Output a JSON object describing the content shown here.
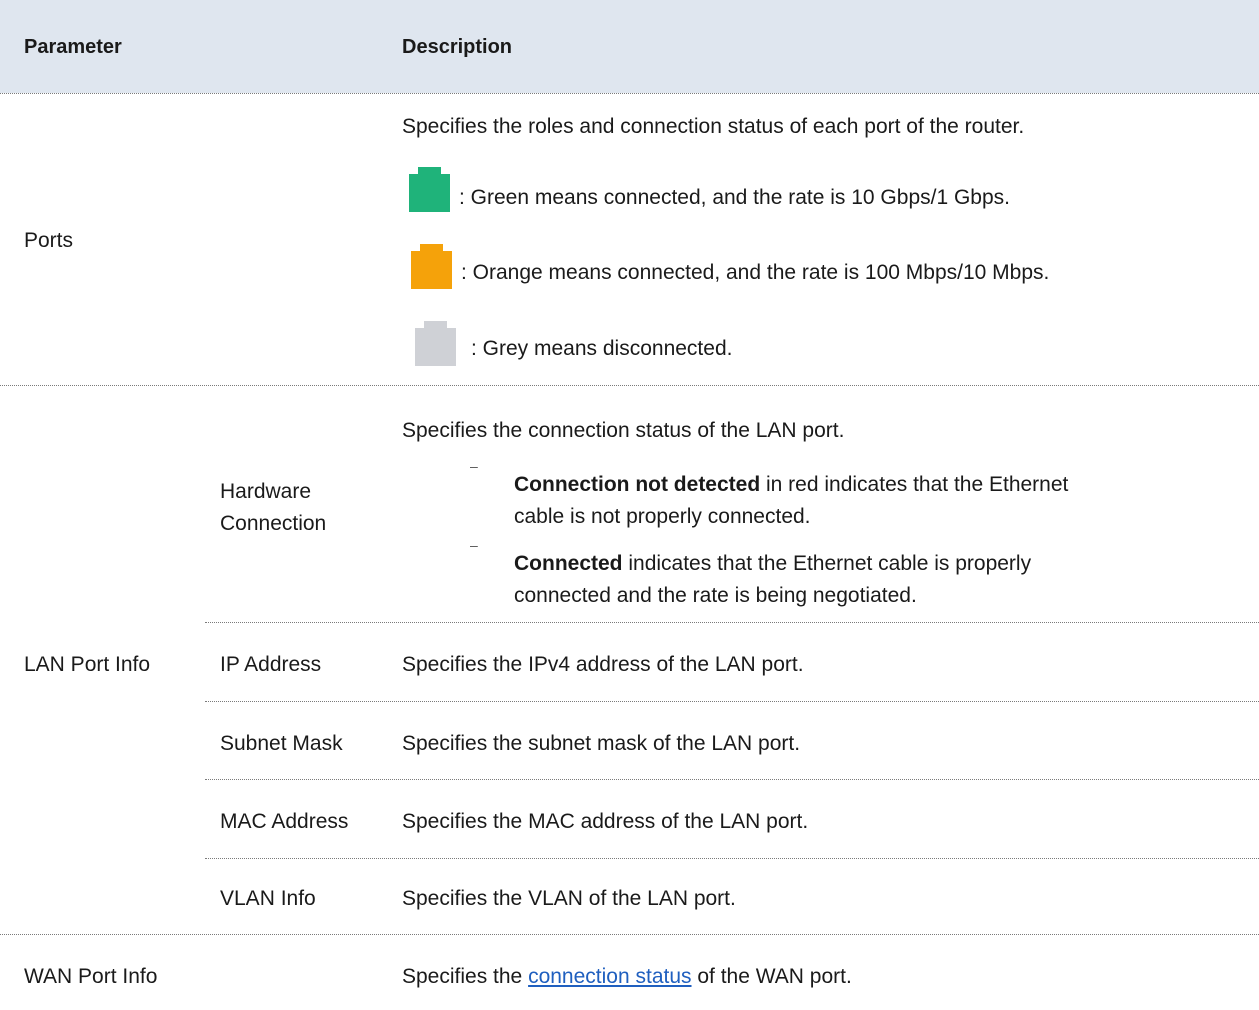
{
  "table": {
    "headers": {
      "parameter": "Parameter",
      "description": "Description"
    },
    "ports": {
      "label": "Ports",
      "intro": "Specifies the roles and connection status of each port of the router.",
      "legend": [
        {
          "icon": "green-port-icon",
          "color": "#1fb37a",
          "text": ": Green means connected, and the rate is 10 Gbps/1 Gbps."
        },
        {
          "icon": "orange-port-icon",
          "color": "#f5a20a",
          "text": ": Orange means connected, and the rate is 100 Mbps/10 Mbps."
        },
        {
          "icon": "grey-port-icon",
          "color": "#cfd1d6",
          "text": ": Grey means disconnected."
        }
      ]
    },
    "lan": {
      "label": "LAN Port Info",
      "hardware": {
        "label_line1": "Hardware",
        "label_line2": "Connection",
        "intro": "Specifies the connection status of the LAN port.",
        "bullet1_bold": "Connection not detected",
        "bullet1_rest": " in red indicates that the Ethernet",
        "bullet1_line2": "cable is not properly connected.",
        "bullet2_bold": "Connected",
        "bullet2_rest": " indicates that the Ethernet cable is properly",
        "bullet2_line2": "connected and the rate is being negotiated.",
        "bullet_marker": "–"
      },
      "rows": [
        {
          "label": "IP Address",
          "desc": "Specifies the IPv4 address of the LAN port."
        },
        {
          "label": "Subnet Mask",
          "desc": "Specifies the subnet mask of the LAN port."
        },
        {
          "label": "MAC Address",
          "desc": "Specifies the MAC address of the LAN port."
        },
        {
          "label": "VLAN Info",
          "desc": "Specifies the VLAN of the LAN port."
        }
      ]
    },
    "wan": {
      "label": "WAN Port Info",
      "desc_prefix": "Specifies the ",
      "desc_link": "connection status",
      "desc_suffix": " of the WAN port."
    }
  }
}
